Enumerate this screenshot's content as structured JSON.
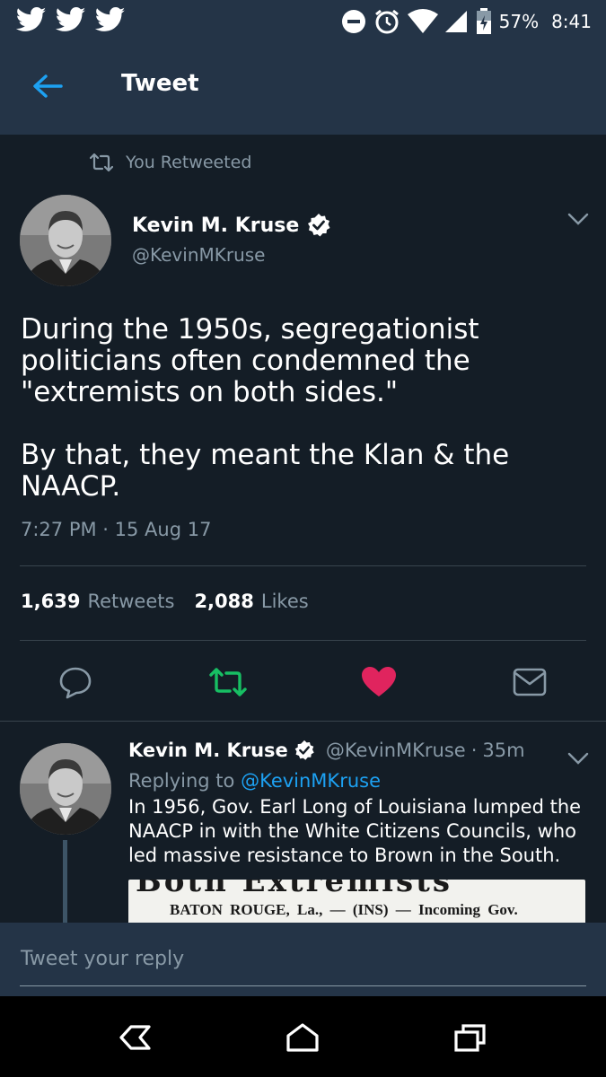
{
  "status_bar": {
    "notification_icons": [
      "twitter-bird-icon",
      "twitter-bird-icon",
      "twitter-bird-icon"
    ],
    "battery": "57%",
    "time": "8:41"
  },
  "app_bar": {
    "title": "Tweet"
  },
  "tweet": {
    "retweet_label": "You Retweeted",
    "author_name": "Kevin M. Kruse",
    "author_handle": "@KevinMKruse",
    "verified": true,
    "text": "During the 1950s, segregationist politicians often condemned the \"extremists on both sides.\"\n\nBy that, they meant the Klan & the NAACP.",
    "timestamp": "7:27 PM · 15 Aug 17",
    "retweets_count": "1,639",
    "retweets_label": "Retweets",
    "likes_count": "2,088",
    "likes_label": "Likes",
    "liked": true,
    "retweeted": true
  },
  "reply": {
    "author_name": "Kevin M. Kruse",
    "author_handle": "@KevinMKruse",
    "separator": "·",
    "time": "35m",
    "replying_to_label": "Replying to",
    "replying_to_handle": "@KevinMKruse",
    "text": "In 1956, Gov. Earl Long of Louisiana lumped the NAACP in with the White Citizens Councils, who led massive resistance to Brown in the South.",
    "media_headline": "Both Extremists",
    "media_dateline": "BATON ROUGE, La., — (INS) — Incoming Gov."
  },
  "composer": {
    "placeholder": "Tweet your reply"
  },
  "colors": {
    "background": "#141d26",
    "bar": "#243447",
    "secondary_text": "#8899a6",
    "link": "#1da1f2",
    "retweet_green": "#17bf63",
    "like_red": "#e0245e"
  }
}
